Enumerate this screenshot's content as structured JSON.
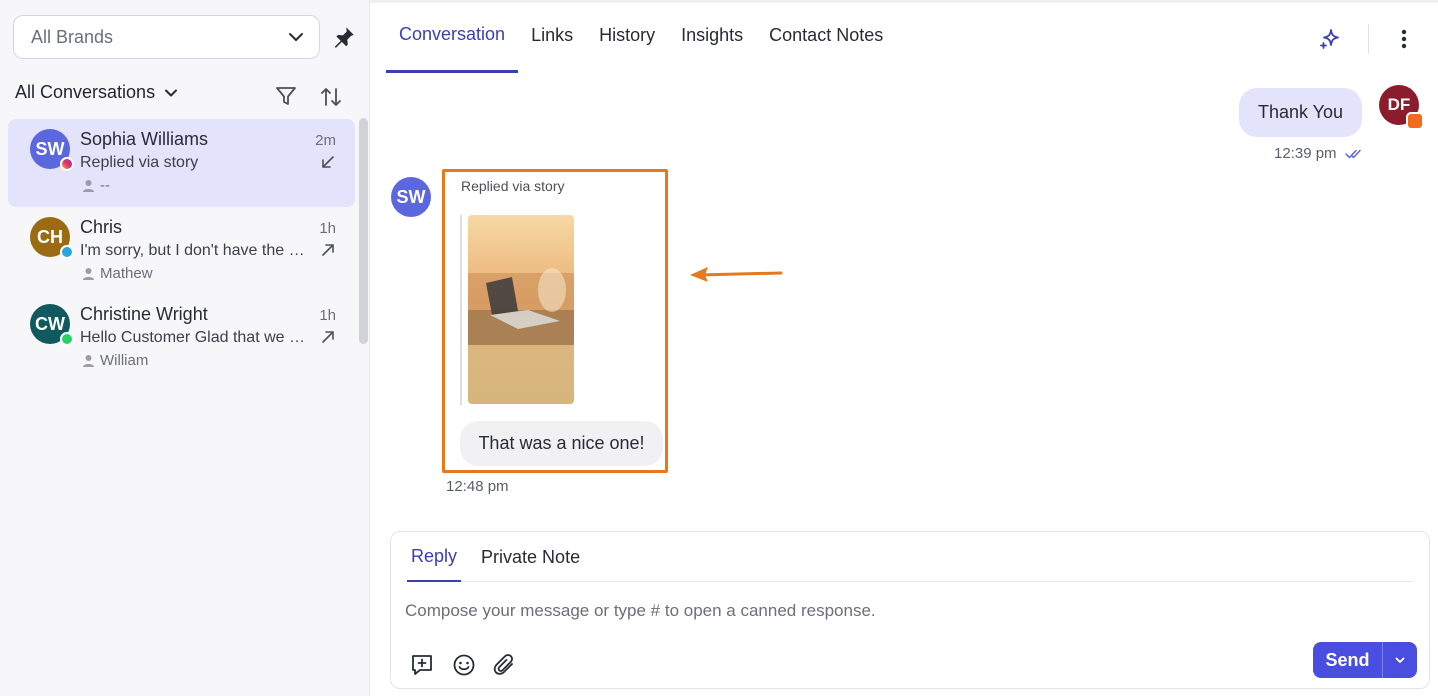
{
  "sidebar": {
    "brand_select": {
      "value": "All Brands"
    },
    "conversation_filter": {
      "label": "All Conversations"
    },
    "conversations": [
      {
        "initials": "SW",
        "name": "Sophia Williams",
        "time": "2m",
        "preview": "Replied via story",
        "agent": "--",
        "channel": "instagram",
        "avatar_color": "#5b67dd"
      },
      {
        "initials": "CH",
        "name": "Chris",
        "time": "1h",
        "preview": "I'm sorry, but I don't have the specific details",
        "agent": "Mathew",
        "channel": "telegram",
        "avatar_color": "#9a6b12"
      },
      {
        "initials": "CW",
        "name": "Christine Wright",
        "time": "1h",
        "preview": "Hello Customer Glad that we could help",
        "agent": "William",
        "channel": "whatsapp",
        "avatar_color": "#0f5a5e"
      }
    ]
  },
  "header": {
    "tabs": [
      {
        "label": "Conversation"
      },
      {
        "label": "Links"
      },
      {
        "label": "History"
      },
      {
        "label": "Insights"
      },
      {
        "label": "Contact Notes"
      }
    ]
  },
  "messages": {
    "outgoing": {
      "text": "Thank You",
      "time": "12:39 pm",
      "avatar_initials": "DF"
    },
    "incoming": {
      "avatar_initials": "SW",
      "context_label": "Replied via story",
      "text": "That was a nice one!",
      "time": "12:48 pm"
    }
  },
  "composer": {
    "tabs": [
      {
        "label": "Reply"
      },
      {
        "label": "Private Note"
      }
    ],
    "placeholder": "Compose your message or type # to open a canned response.",
    "send_label": "Send"
  },
  "colors": {
    "accent": "#3a3fb1",
    "send_button": "#4a4ee0",
    "highlight_box": "#e4791f",
    "active_row": "#e3e3fb"
  },
  "icons": [
    "chevron-down-icon",
    "pin-icon",
    "filter-icon",
    "sort-icon",
    "instagram-icon",
    "telegram-icon",
    "whatsapp-icon",
    "agent-icon",
    "sparkle-icon",
    "kebab-icon",
    "double-check-icon",
    "canned-response-icon",
    "emoji-icon",
    "attachment-icon"
  ]
}
